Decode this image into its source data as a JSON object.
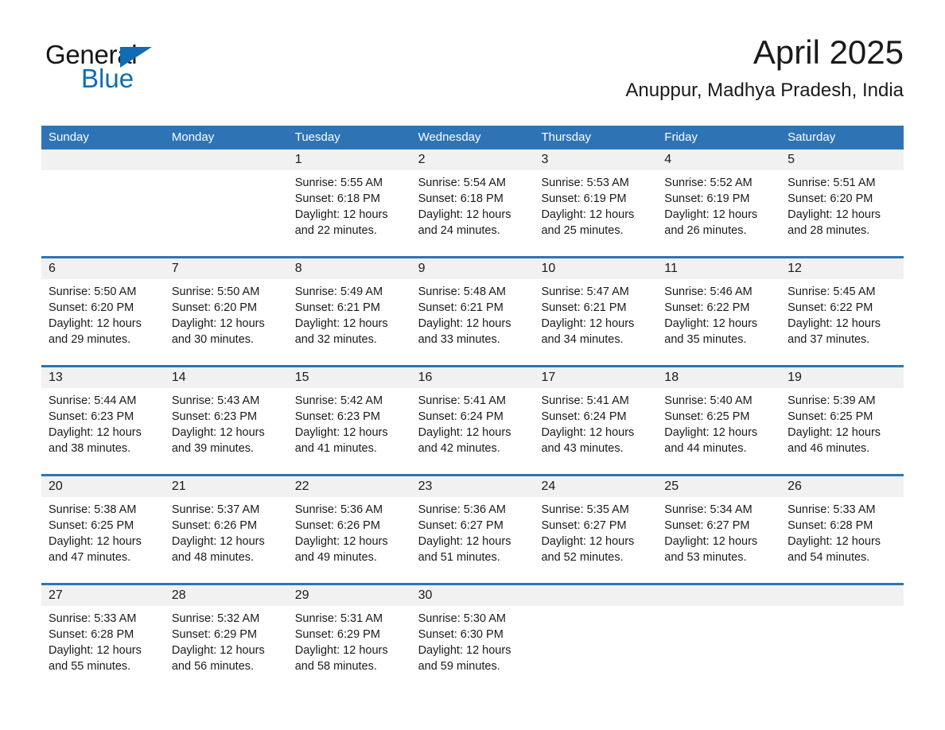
{
  "logo": {
    "word_one": "General",
    "word_two": "Blue",
    "triangle_icon": "triangle-icon",
    "brand_color": "#0f6cb6"
  },
  "header": {
    "title": "April 2025",
    "location": "Anuppur, Madhya Pradesh, India"
  },
  "calendar": {
    "header_color": "#2e74b5",
    "date_band_color": "#f1f1f1",
    "day_names": [
      "Sunday",
      "Monday",
      "Tuesday",
      "Wednesday",
      "Thursday",
      "Friday",
      "Saturday"
    ],
    "weeks": [
      [
        {
          "day": "",
          "l1": "",
          "l2": "",
          "l3": "",
          "l4": ""
        },
        {
          "day": "",
          "l1": "",
          "l2": "",
          "l3": "",
          "l4": ""
        },
        {
          "day": "1",
          "l1": "Sunrise: 5:55 AM",
          "l2": "Sunset: 6:18 PM",
          "l3": "Daylight: 12 hours",
          "l4": "and 22 minutes."
        },
        {
          "day": "2",
          "l1": "Sunrise: 5:54 AM",
          "l2": "Sunset: 6:18 PM",
          "l3": "Daylight: 12 hours",
          "l4": "and 24 minutes."
        },
        {
          "day": "3",
          "l1": "Sunrise: 5:53 AM",
          "l2": "Sunset: 6:19 PM",
          "l3": "Daylight: 12 hours",
          "l4": "and 25 minutes."
        },
        {
          "day": "4",
          "l1": "Sunrise: 5:52 AM",
          "l2": "Sunset: 6:19 PM",
          "l3": "Daylight: 12 hours",
          "l4": "and 26 minutes."
        },
        {
          "day": "5",
          "l1": "Sunrise: 5:51 AM",
          "l2": "Sunset: 6:20 PM",
          "l3": "Daylight: 12 hours",
          "l4": "and 28 minutes."
        }
      ],
      [
        {
          "day": "6",
          "l1": "Sunrise: 5:50 AM",
          "l2": "Sunset: 6:20 PM",
          "l3": "Daylight: 12 hours",
          "l4": "and 29 minutes."
        },
        {
          "day": "7",
          "l1": "Sunrise: 5:50 AM",
          "l2": "Sunset: 6:20 PM",
          "l3": "Daylight: 12 hours",
          "l4": "and 30 minutes."
        },
        {
          "day": "8",
          "l1": "Sunrise: 5:49 AM",
          "l2": "Sunset: 6:21 PM",
          "l3": "Daylight: 12 hours",
          "l4": "and 32 minutes."
        },
        {
          "day": "9",
          "l1": "Sunrise: 5:48 AM",
          "l2": "Sunset: 6:21 PM",
          "l3": "Daylight: 12 hours",
          "l4": "and 33 minutes."
        },
        {
          "day": "10",
          "l1": "Sunrise: 5:47 AM",
          "l2": "Sunset: 6:21 PM",
          "l3": "Daylight: 12 hours",
          "l4": "and 34 minutes."
        },
        {
          "day": "11",
          "l1": "Sunrise: 5:46 AM",
          "l2": "Sunset: 6:22 PM",
          "l3": "Daylight: 12 hours",
          "l4": "and 35 minutes."
        },
        {
          "day": "12",
          "l1": "Sunrise: 5:45 AM",
          "l2": "Sunset: 6:22 PM",
          "l3": "Daylight: 12 hours",
          "l4": "and 37 minutes."
        }
      ],
      [
        {
          "day": "13",
          "l1": "Sunrise: 5:44 AM",
          "l2": "Sunset: 6:23 PM",
          "l3": "Daylight: 12 hours",
          "l4": "and 38 minutes."
        },
        {
          "day": "14",
          "l1": "Sunrise: 5:43 AM",
          "l2": "Sunset: 6:23 PM",
          "l3": "Daylight: 12 hours",
          "l4": "and 39 minutes."
        },
        {
          "day": "15",
          "l1": "Sunrise: 5:42 AM",
          "l2": "Sunset: 6:23 PM",
          "l3": "Daylight: 12 hours",
          "l4": "and 41 minutes."
        },
        {
          "day": "16",
          "l1": "Sunrise: 5:41 AM",
          "l2": "Sunset: 6:24 PM",
          "l3": "Daylight: 12 hours",
          "l4": "and 42 minutes."
        },
        {
          "day": "17",
          "l1": "Sunrise: 5:41 AM",
          "l2": "Sunset: 6:24 PM",
          "l3": "Daylight: 12 hours",
          "l4": "and 43 minutes."
        },
        {
          "day": "18",
          "l1": "Sunrise: 5:40 AM",
          "l2": "Sunset: 6:25 PM",
          "l3": "Daylight: 12 hours",
          "l4": "and 44 minutes."
        },
        {
          "day": "19",
          "l1": "Sunrise: 5:39 AM",
          "l2": "Sunset: 6:25 PM",
          "l3": "Daylight: 12 hours",
          "l4": "and 46 minutes."
        }
      ],
      [
        {
          "day": "20",
          "l1": "Sunrise: 5:38 AM",
          "l2": "Sunset: 6:25 PM",
          "l3": "Daylight: 12 hours",
          "l4": "and 47 minutes."
        },
        {
          "day": "21",
          "l1": "Sunrise: 5:37 AM",
          "l2": "Sunset: 6:26 PM",
          "l3": "Daylight: 12 hours",
          "l4": "and 48 minutes."
        },
        {
          "day": "22",
          "l1": "Sunrise: 5:36 AM",
          "l2": "Sunset: 6:26 PM",
          "l3": "Daylight: 12 hours",
          "l4": "and 49 minutes."
        },
        {
          "day": "23",
          "l1": "Sunrise: 5:36 AM",
          "l2": "Sunset: 6:27 PM",
          "l3": "Daylight: 12 hours",
          "l4": "and 51 minutes."
        },
        {
          "day": "24",
          "l1": "Sunrise: 5:35 AM",
          "l2": "Sunset: 6:27 PM",
          "l3": "Daylight: 12 hours",
          "l4": "and 52 minutes."
        },
        {
          "day": "25",
          "l1": "Sunrise: 5:34 AM",
          "l2": "Sunset: 6:27 PM",
          "l3": "Daylight: 12 hours",
          "l4": "and 53 minutes."
        },
        {
          "day": "26",
          "l1": "Sunrise: 5:33 AM",
          "l2": "Sunset: 6:28 PM",
          "l3": "Daylight: 12 hours",
          "l4": "and 54 minutes."
        }
      ],
      [
        {
          "day": "27",
          "l1": "Sunrise: 5:33 AM",
          "l2": "Sunset: 6:28 PM",
          "l3": "Daylight: 12 hours",
          "l4": "and 55 minutes."
        },
        {
          "day": "28",
          "l1": "Sunrise: 5:32 AM",
          "l2": "Sunset: 6:29 PM",
          "l3": "Daylight: 12 hours",
          "l4": "and 56 minutes."
        },
        {
          "day": "29",
          "l1": "Sunrise: 5:31 AM",
          "l2": "Sunset: 6:29 PM",
          "l3": "Daylight: 12 hours",
          "l4": "and 58 minutes."
        },
        {
          "day": "30",
          "l1": "Sunrise: 5:30 AM",
          "l2": "Sunset: 6:30 PM",
          "l3": "Daylight: 12 hours",
          "l4": "and 59 minutes."
        },
        {
          "day": "",
          "l1": "",
          "l2": "",
          "l3": "",
          "l4": ""
        },
        {
          "day": "",
          "l1": "",
          "l2": "",
          "l3": "",
          "l4": ""
        },
        {
          "day": "",
          "l1": "",
          "l2": "",
          "l3": "",
          "l4": ""
        }
      ]
    ]
  }
}
